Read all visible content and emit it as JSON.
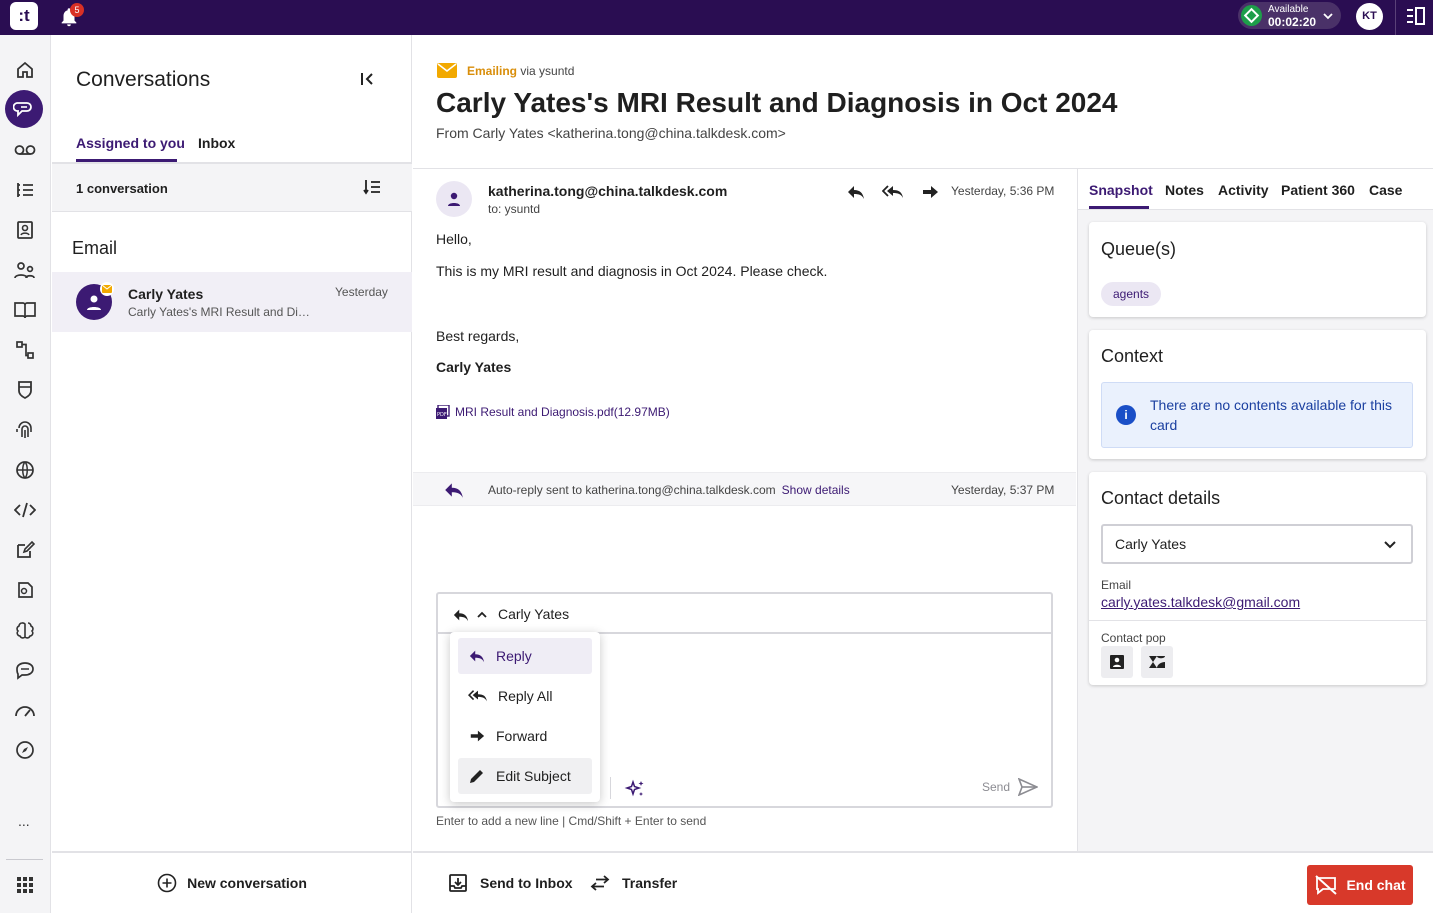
{
  "topbar": {
    "logo_text": ":t",
    "notifications_count": "5",
    "status_label": "Available",
    "status_timer": "00:02:20",
    "user_initials": "KT"
  },
  "rail": {
    "icons": [
      "home-icon",
      "conversations-icon",
      "voicemail-icon",
      "list-icon",
      "contacts-icon",
      "team-icon",
      "knowledge-icon",
      "workflow-icon",
      "shield-icon",
      "fingerprint-icon",
      "globe-icon",
      "code-icon",
      "edit-icon",
      "ai-icon",
      "brain-icon",
      "chat-bubble-icon",
      "speedometer-icon",
      "compass-icon"
    ],
    "more_label": "...",
    "apps_icon": "grid-icon"
  },
  "conversations": {
    "title": "Conversations",
    "tabs": [
      {
        "label": "Assigned to you"
      },
      {
        "label": "Inbox"
      }
    ],
    "count_label": "1 conversation",
    "group_title": "Email",
    "items": [
      {
        "name": "Carly Yates",
        "preview": "Carly Yates's MRI Result and Diagnosis in Oct 2024",
        "time": "Yesterday"
      }
    ],
    "new_conversation_label": "New conversation"
  },
  "email": {
    "channel": "Emailing",
    "via": "via ysuntd",
    "title": "Carly Yates's MRI Result and Diagnosis in Oct 2024",
    "from": "From Carly Yates <katherina.tong@china.talkdesk.com>",
    "sender": "katherina.tong@china.talkdesk.com",
    "to": "to: ysuntd",
    "time": "Yesterday, 5:36 PM",
    "body": {
      "greeting": "Hello,",
      "line1": "This is my MRI result and diagnosis in Oct 2024. Please check.",
      "closing": "Best regards,",
      "signature": "Carly Yates"
    },
    "attachment": "MRI Result and Diagnosis.pdf(12.97MB)",
    "autoreply": {
      "text": "Auto-reply sent to katherina.tong@china.talkdesk.com",
      "link": "Show details",
      "time": "Yesterday, 5:37 PM"
    }
  },
  "composer": {
    "to": "Carly Yates",
    "send_label": "Send",
    "hint": "Enter to add a new line | Cmd/Shift + Enter to send",
    "menu": [
      {
        "label": "Reply",
        "icon": "reply-icon"
      },
      {
        "label": "Reply All",
        "icon": "reply-all-icon"
      },
      {
        "label": "Forward",
        "icon": "forward-icon"
      },
      {
        "label": "Edit Subject",
        "icon": "pencil-icon"
      }
    ]
  },
  "footer": {
    "send_to_inbox": "Send to Inbox",
    "transfer": "Transfer",
    "end_chat": "End chat"
  },
  "right_panel": {
    "tabs": [
      {
        "label": "Snapshot"
      },
      {
        "label": "Notes"
      },
      {
        "label": "Activity"
      },
      {
        "label": "Patient 360"
      },
      {
        "label": "Case"
      }
    ],
    "queues_title": "Queue(s)",
    "queue_chip": "agents",
    "context_title": "Context",
    "context_empty": "There are no contents available for this card",
    "contact_title": "Contact details",
    "contact_selected": "Carly Yates",
    "email_label": "Email",
    "email_value": "carly.yates.talkdesk@gmail.com",
    "contact_pop_label": "Contact pop"
  },
  "colors": {
    "topbar": "#2a0d52",
    "accent": "#3c1a73",
    "email_channel": "#d98e0a",
    "end_chat": "#d8392a",
    "status_available": "#1e9e4a"
  }
}
